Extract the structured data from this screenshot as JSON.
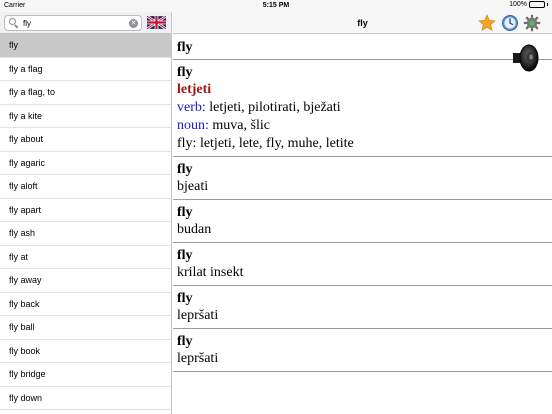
{
  "status_bar": {
    "carrier": "Carrier",
    "time": "5:15 PM",
    "battery": "100%"
  },
  "search": {
    "value": "fly",
    "flag_icon": "uk-flag-icon"
  },
  "word_list": [
    "fly",
    "fly a flag",
    "fly a flag, to",
    "fly a kite",
    "fly about",
    "fly agaric",
    "fly aloft",
    "fly apart",
    "fly ash",
    "fly at",
    "fly away",
    "fly back",
    "fly ball",
    "fly book",
    "fly bridge",
    "fly down"
  ],
  "nav": {
    "title": "fly",
    "icons": [
      "star-icon",
      "clock-icon",
      "gear-icon"
    ]
  },
  "entries": [
    {
      "head": "fly"
    },
    {
      "head": "fly",
      "main": "letjeti",
      "verb_label": "verb:",
      "verb_text": " letjeti, pilotirati, bježati",
      "noun_label": "noun:",
      "noun_text": " muva, šlic",
      "extra": "fly: letjeti, lete, fly, muhe, letite"
    },
    {
      "head": "fly",
      "text": "bjeati"
    },
    {
      "head": "fly",
      "text": "budan"
    },
    {
      "head": "fly",
      "text": "krilat insekt"
    },
    {
      "head": "fly",
      "text": "lepršati"
    },
    {
      "head": "fly",
      "text": "lepršati"
    }
  ],
  "colors": {
    "selected_row": "#c8c8c8",
    "main_translation": "#a31515",
    "part_of_speech": "#1a1acc"
  }
}
